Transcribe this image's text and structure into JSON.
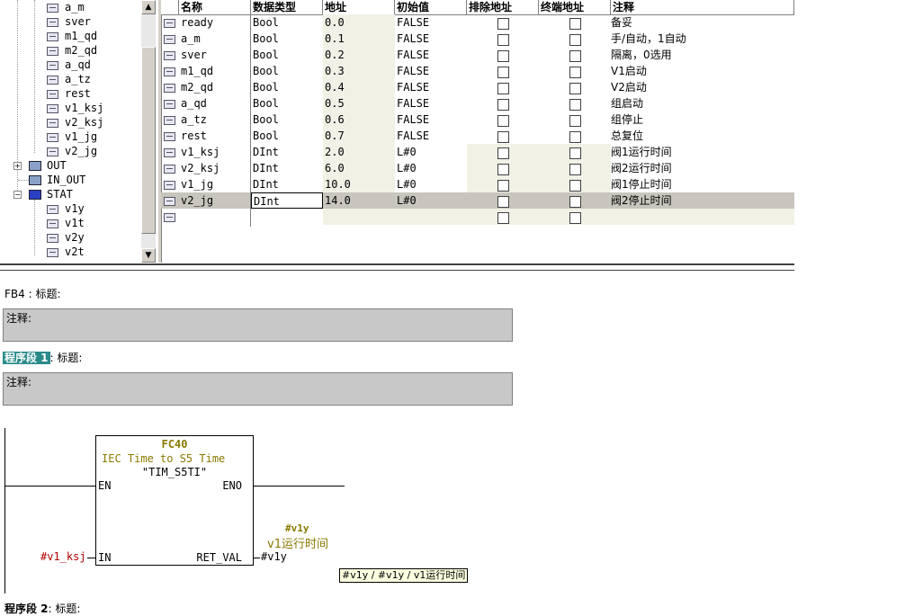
{
  "tree": {
    "items": [
      {
        "label": "a_m",
        "kind": "var"
      },
      {
        "label": "sver",
        "kind": "var"
      },
      {
        "label": "m1_qd",
        "kind": "var"
      },
      {
        "label": "m2_qd",
        "kind": "var"
      },
      {
        "label": "a_qd",
        "kind": "var"
      },
      {
        "label": "a_tz",
        "kind": "var"
      },
      {
        "label": "rest",
        "kind": "var"
      },
      {
        "label": "v1_ksj",
        "kind": "var"
      },
      {
        "label": "v2_ksj",
        "kind": "var"
      },
      {
        "label": "v1_jg",
        "kind": "var"
      },
      {
        "label": "v2_jg",
        "kind": "var"
      },
      {
        "label": "OUT",
        "kind": "folder",
        "expander": "+"
      },
      {
        "label": "IN_OUT",
        "kind": "folder",
        "expander": ""
      },
      {
        "label": "STAT",
        "kind": "folder",
        "expander": "-"
      },
      {
        "label": "v1y",
        "kind": "var"
      },
      {
        "label": "v1t",
        "kind": "var"
      },
      {
        "label": "v2y",
        "kind": "var"
      },
      {
        "label": "v2t",
        "kind": "var"
      }
    ]
  },
  "table": {
    "headers": {
      "name": "名称",
      "type": "数据类型",
      "addr": "地址",
      "init": "初始值",
      "excl": "排除地址",
      "term": "终端地址",
      "comment": "注释"
    },
    "rows": [
      {
        "name": "ready",
        "type": "Bool",
        "addr": "0.0",
        "init": "FALSE",
        "comment": "备妥"
      },
      {
        "name": "a_m",
        "type": "Bool",
        "addr": "0.1",
        "init": "FALSE",
        "comment": "手/自动，1自动"
      },
      {
        "name": "sver",
        "type": "Bool",
        "addr": "0.2",
        "init": "FALSE",
        "comment": "隔离，0选用"
      },
      {
        "name": "m1_qd",
        "type": "Bool",
        "addr": "0.3",
        "init": "FALSE",
        "comment": "V1启动"
      },
      {
        "name": "m2_qd",
        "type": "Bool",
        "addr": "0.4",
        "init": "FALSE",
        "comment": "V2启动"
      },
      {
        "name": "a_qd",
        "type": "Bool",
        "addr": "0.5",
        "init": "FALSE",
        "comment": "组启动"
      },
      {
        "name": "a_tz",
        "type": "Bool",
        "addr": "0.6",
        "init": "FALSE",
        "comment": "组停止"
      },
      {
        "name": "rest",
        "type": "Bool",
        "addr": "0.7",
        "init": "FALSE",
        "comment": "总复位"
      },
      {
        "name": "v1_ksj",
        "type": "DInt",
        "addr": "2.0",
        "init": "L#0",
        "comment": "阀1运行时间"
      },
      {
        "name": "v2_ksj",
        "type": "DInt",
        "addr": "6.0",
        "init": "L#0",
        "comment": "阀2运行时间"
      },
      {
        "name": "v1_jg",
        "type": "DInt",
        "addr": "10.0",
        "init": "L#0",
        "comment": "阀1停止时间"
      },
      {
        "name": "v2_jg",
        "type": "DInt",
        "addr": "14.0",
        "init": "L#0",
        "comment": "阀2停止时间",
        "selected": true
      },
      {
        "name": "",
        "type": "",
        "addr": "",
        "init": "",
        "comment": "",
        "empty": true
      }
    ]
  },
  "editor": {
    "fb_title": "FB4 : 标题:",
    "comment_label": "注释:",
    "network1_label": "程序段 1",
    "network1_suffix": ": 标题:",
    "network2_label": "程序段 2",
    "network2_suffix": ": 标题:",
    "block": {
      "number": "FC40",
      "description": "IEC Time to S5 Time",
      "symbol": "\"TIM_S5TI\"",
      "pin_en": "EN",
      "pin_eno": "ENO",
      "pin_in": "IN",
      "pin_ret": "RET_VAL"
    },
    "in_operand": "#v1_ksj",
    "out_operand": "#v1y",
    "out_symbol_name": "#v1y",
    "out_symbol_comment": "v1运行时间",
    "tooltip": "#v1y / #v1y / v1运行时间"
  },
  "colors": {
    "highlight": "#2a8a8a",
    "olive": "#8a7a00",
    "operand_red": "#b00000",
    "selected_row": "#c8c5bc",
    "comment_box": "#c8c8c8"
  }
}
